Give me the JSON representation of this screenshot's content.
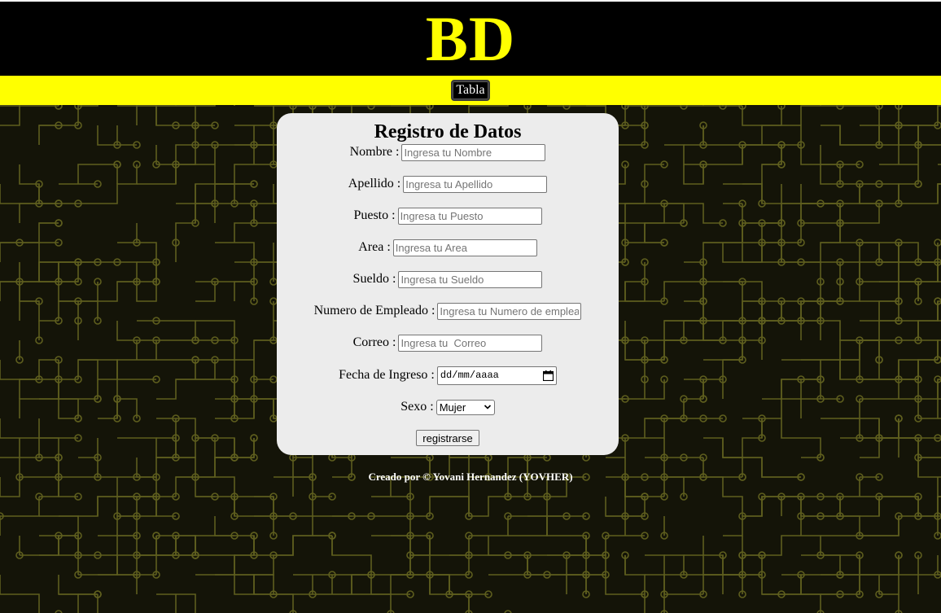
{
  "colors": {
    "accent": "#ffff00",
    "header_bg": "#000000",
    "card_bg": "#ececec",
    "circuit_line": "#5e5e1e",
    "page_bg": "#141408"
  },
  "header": {
    "title": "BD"
  },
  "nav": {
    "tabla_label": "Tabla"
  },
  "form": {
    "title": "Registro de Datos",
    "fields": [
      {
        "label": "Nombre :",
        "placeholder": "Ingresa tu Nombre",
        "value": ""
      },
      {
        "label": "Apellido :",
        "placeholder": "Ingresa tu Apellido",
        "value": ""
      },
      {
        "label": "Puesto :",
        "placeholder": "Ingresa tu Puesto",
        "value": ""
      },
      {
        "label": "Area :",
        "placeholder": "Ingresa tu Area",
        "value": ""
      },
      {
        "label": "Sueldo :",
        "placeholder": "Ingresa tu Sueldo",
        "value": ""
      },
      {
        "label": "Numero de Empleado :",
        "placeholder": "Ingresa tu Numero de empleado",
        "value": ""
      },
      {
        "label": "Correo :",
        "placeholder": "Ingresa tu  Correo",
        "value": ""
      }
    ],
    "date_field": {
      "label": "Fecha de Ingreso :",
      "placeholder": "dd/mm/aaaa",
      "icon": "calendar-icon"
    },
    "sex_field": {
      "label": "Sexo :",
      "selected": "Mujer",
      "icon": "chevron-down-icon"
    },
    "submit_label": "registrarse"
  },
  "footer": {
    "credit": "Creado por © Yovani Hernandez (YOVHER)"
  }
}
